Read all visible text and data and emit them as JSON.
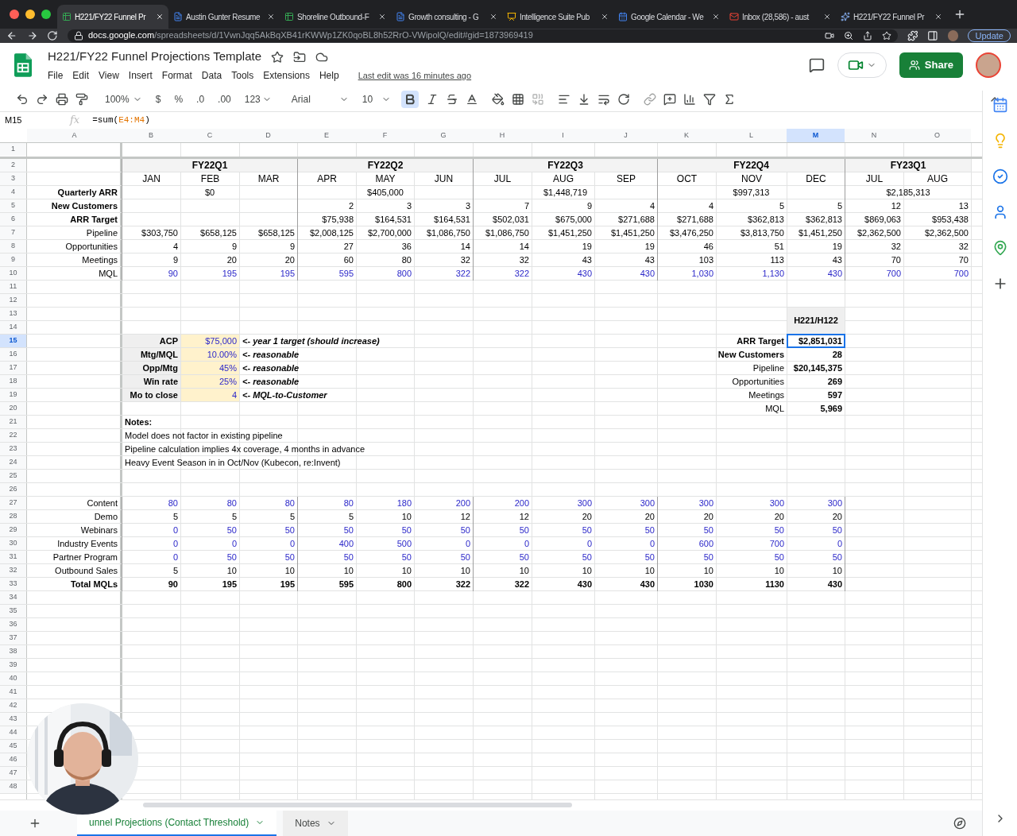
{
  "browser": {
    "tabs": [
      {
        "label": "H221/FY22 Funnel Pr",
        "kind": "sheets",
        "selected": true
      },
      {
        "label": "Austin Gunter Resume",
        "kind": "docs",
        "selected": false
      },
      {
        "label": "Shoreline Outbound-F",
        "kind": "sheets",
        "selected": false
      },
      {
        "label": "Growth consulting - G",
        "kind": "docs",
        "selected": false
      },
      {
        "label": "Intelligence Suite Pub",
        "kind": "slides",
        "selected": false
      },
      {
        "label": "Google Calendar - We",
        "kind": "calendar",
        "selected": false
      },
      {
        "label": "Inbox (28,586) - aust",
        "kind": "mail",
        "selected": false
      },
      {
        "label": "H221/FY22 Funnel Pr",
        "kind": "spark",
        "selected": false
      }
    ],
    "address": {
      "host": "docs.google.com",
      "path": "/spreadsheets/d/1VwnJqq5AkBqXB41rKWWp1ZK0qoBL8h52RrO-VWipolQ/edit#gid=1873969419"
    },
    "update_button": "Update"
  },
  "doc": {
    "title": "H221/FY22 Funnel Projections Template",
    "menu": [
      "File",
      "Edit",
      "View",
      "Insert",
      "Format",
      "Data",
      "Tools",
      "Extensions",
      "Help"
    ],
    "last_edit": "Last edit was 16 minutes ago",
    "share": "Share"
  },
  "toolbar": {
    "zoom": "100%",
    "currency": "$",
    "percent": "%",
    "decrease_decimals": ".0",
    "increase_decimals": ".00",
    "more_formats": "123",
    "font": "Arial",
    "font_size": "10",
    "bold_on": true
  },
  "formula_bar": {
    "name_box": "M15",
    "fx": "fx",
    "prefix": "=sum(",
    "ref": "E4:M4",
    "suffix": ")"
  },
  "columns": [
    {
      "label": "A",
      "selected": false
    },
    {
      "label": "B",
      "selected": false
    },
    {
      "label": "C",
      "selected": false
    },
    {
      "label": "D",
      "selected": false
    },
    {
      "label": "E",
      "selected": false
    },
    {
      "label": "F",
      "selected": false
    },
    {
      "label": "G",
      "selected": false
    },
    {
      "label": "H",
      "selected": false
    },
    {
      "label": "I",
      "selected": false
    },
    {
      "label": "J",
      "selected": false
    },
    {
      "label": "K",
      "selected": false
    },
    {
      "label": "L",
      "selected": false
    },
    {
      "label": "M",
      "selected": true
    },
    {
      "label": "N",
      "selected": false
    },
    {
      "label": "O",
      "selected": false
    }
  ],
  "rows": [
    {
      "n": "1",
      "selected": false,
      "kind": "empty"
    },
    {
      "n": "2",
      "selected": false,
      "kind": "quarters",
      "values": [
        "FY22Q1",
        "FY22Q2",
        "FY22Q3",
        "FY22Q4",
        "FY23Q1"
      ]
    },
    {
      "n": "3",
      "selected": false,
      "kind": "months",
      "values": [
        "JAN",
        "FEB",
        "MAR",
        "APR",
        "MAY",
        "JUN",
        "JUL",
        "AUG",
        "SEP",
        "OCT",
        "NOV",
        "DEC",
        "JUL",
        "AUG"
      ]
    },
    {
      "n": "4",
      "selected": false,
      "kind": "quarterly",
      "label": "Quarterly ARR",
      "values": [
        "$0",
        "$405,000",
        "$1,448,719",
        "$997,313",
        "$2,185,313"
      ]
    },
    {
      "n": "5",
      "selected": false,
      "kind": "q2start",
      "label": "New Customers",
      "label_bold": true,
      "values": [
        "2",
        "3",
        "3",
        "7",
        "9",
        "4",
        "4",
        "5",
        "5",
        "12",
        "13"
      ]
    },
    {
      "n": "6",
      "selected": false,
      "kind": "q2start",
      "label": "ARR Target",
      "label_bold": true,
      "values": [
        "$75,938",
        "$164,531",
        "$164,531",
        "$502,031",
        "$675,000",
        "$271,688",
        "$271,688",
        "$362,813",
        "$362,813",
        "$869,063",
        "$953,438"
      ]
    },
    {
      "n": "7",
      "selected": false,
      "kind": "plain",
      "label": "Pipeline",
      "label_bold": false,
      "values": [
        "$303,750",
        "$658,125",
        "$658,125",
        "$2,008,125",
        "$2,700,000",
        "$1,086,750",
        "$1,086,750",
        "$1,451,250",
        "$1,451,250",
        "$3,476,250",
        "$3,813,750",
        "$1,451,250",
        "$2,362,500",
        "$2,362,500"
      ]
    },
    {
      "n": "8",
      "selected": false,
      "kind": "plain",
      "label": "Opportunities",
      "label_bold": false,
      "values": [
        "4",
        "9",
        "9",
        "27",
        "36",
        "14",
        "14",
        "19",
        "19",
        "46",
        "51",
        "19",
        "32",
        "32"
      ]
    },
    {
      "n": "9",
      "selected": false,
      "kind": "plain",
      "label": "Meetings",
      "label_bold": false,
      "values": [
        "9",
        "20",
        "20",
        "60",
        "80",
        "32",
        "32",
        "43",
        "43",
        "103",
        "113",
        "43",
        "70",
        "70"
      ]
    },
    {
      "n": "10",
      "selected": false,
      "kind": "blue",
      "label": "MQL",
      "label_bold": false,
      "values": [
        "90",
        "195",
        "195",
        "595",
        "800",
        "322",
        "322",
        "430",
        "430",
        "1,030",
        "1,130",
        "430",
        "700",
        "700"
      ]
    },
    {
      "n": "11",
      "selected": false,
      "kind": "empty"
    },
    {
      "n": "12",
      "selected": false,
      "kind": "empty"
    },
    {
      "n": "13",
      "selected": false,
      "kind": "block",
      "summary_header": "H221/H122"
    },
    {
      "n": "14",
      "selected": false,
      "kind": "empty"
    },
    {
      "n": "15",
      "selected": true,
      "kind": "block",
      "key": "ACP",
      "input": "$75,000",
      "note": "<- year 1 target (should increase)",
      "summary_label": "ARR Target",
      "summary_label_bold": true,
      "summary_value": "$2,851,031"
    },
    {
      "n": "16",
      "selected": false,
      "kind": "block",
      "key": "Mtg/MQL",
      "input": "10.00%",
      "note": "<- reasonable",
      "summary_label": "New Customers",
      "summary_label_bold": true,
      "summary_value": "28"
    },
    {
      "n": "17",
      "selected": false,
      "kind": "block",
      "key": "Opp/Mtg",
      "input": "45%",
      "note": "<- reasonable",
      "summary_label": "Pipeline",
      "summary_label_bold": false,
      "summary_value": "$20,145,375"
    },
    {
      "n": "18",
      "selected": false,
      "kind": "block",
      "key": "Win rate",
      "input": "25%",
      "note": "<- reasonable",
      "summary_label": "Opportunities",
      "summary_label_bold": false,
      "summary_value": "269"
    },
    {
      "n": "19",
      "selected": false,
      "kind": "block",
      "key": "Mo to close",
      "input": "4",
      "note": "<- MQL-to-Customer",
      "summary_label": "Meetings",
      "summary_label_bold": false,
      "summary_value": "597"
    },
    {
      "n": "20",
      "selected": false,
      "kind": "block",
      "summary_label": "MQL",
      "summary_label_bold": false,
      "summary_value": "5,969"
    },
    {
      "n": "21",
      "selected": false,
      "kind": "note",
      "text": "Notes:",
      "bold": true
    },
    {
      "n": "22",
      "selected": false,
      "kind": "note",
      "text": "Model does not factor in existing pipeline",
      "bold": false
    },
    {
      "n": "23",
      "selected": false,
      "kind": "note",
      "text": "Pipeline calculation implies 4x coverage, 4 months in advance",
      "bold": false
    },
    {
      "n": "24",
      "selected": false,
      "kind": "note",
      "text": "Heavy Event Season in in Oct/Nov (Kubecon, re:Invent)",
      "bold": false
    },
    {
      "n": "25",
      "selected": false,
      "kind": "empty"
    },
    {
      "n": "26",
      "selected": false,
      "kind": "empty"
    },
    {
      "n": "27",
      "selected": false,
      "kind": "blue",
      "label": "Content",
      "label_bold": false,
      "values": [
        "80",
        "80",
        "80",
        "80",
        "180",
        "200",
        "200",
        "300",
        "300",
        "300",
        "300",
        "300"
      ]
    },
    {
      "n": "28",
      "selected": false,
      "kind": "plain",
      "label": "Demo",
      "label_bold": false,
      "values": [
        "5",
        "5",
        "5",
        "5",
        "10",
        "12",
        "12",
        "20",
        "20",
        "20",
        "20",
        "20"
      ]
    },
    {
      "n": "29",
      "selected": false,
      "kind": "blue",
      "label": "Webinars",
      "label_bold": false,
      "values": [
        "0",
        "50",
        "50",
        "50",
        "50",
        "50",
        "50",
        "50",
        "50",
        "50",
        "50",
        "50"
      ]
    },
    {
      "n": "30",
      "selected": false,
      "kind": "blue",
      "label": "Industry Events",
      "label_bold": false,
      "values": [
        "0",
        "0",
        "0",
        "400",
        "500",
        "0",
        "0",
        "0",
        "0",
        "600",
        "700",
        "0"
      ]
    },
    {
      "n": "31",
      "selected": false,
      "kind": "blue",
      "label": "Partner Program",
      "label_bold": false,
      "values": [
        "0",
        "50",
        "50",
        "50",
        "50",
        "50",
        "50",
        "50",
        "50",
        "50",
        "50",
        "50"
      ]
    },
    {
      "n": "32",
      "selected": false,
      "kind": "plain",
      "label": "Outbound Sales",
      "label_bold": false,
      "values": [
        "5",
        "10",
        "10",
        "10",
        "10",
        "10",
        "10",
        "10",
        "10",
        "10",
        "10",
        "10"
      ]
    },
    {
      "n": "33",
      "selected": false,
      "kind": "bold",
      "label": "Total MQLs",
      "label_bold": true,
      "values": [
        "90",
        "195",
        "195",
        "595",
        "800",
        "322",
        "322",
        "430",
        "430",
        "1030",
        "1130",
        "430"
      ]
    },
    {
      "n": "34",
      "selected": false,
      "kind": "empty"
    },
    {
      "n": "35",
      "selected": false,
      "kind": "empty"
    },
    {
      "n": "36",
      "selected": false,
      "kind": "empty"
    },
    {
      "n": "37",
      "selected": false,
      "kind": "empty"
    },
    {
      "n": "38",
      "selected": false,
      "kind": "empty"
    },
    {
      "n": "39",
      "selected": false,
      "kind": "empty"
    },
    {
      "n": "40",
      "selected": false,
      "kind": "empty"
    },
    {
      "n": "41",
      "selected": false,
      "kind": "empty"
    },
    {
      "n": "42",
      "selected": false,
      "kind": "empty"
    },
    {
      "n": "43",
      "selected": false,
      "kind": "empty"
    },
    {
      "n": "44",
      "selected": false,
      "kind": "empty"
    },
    {
      "n": "45",
      "selected": false,
      "kind": "empty"
    },
    {
      "n": "46",
      "selected": false,
      "kind": "empty"
    },
    {
      "n": "47",
      "selected": false,
      "kind": "empty"
    },
    {
      "n": "48",
      "selected": false,
      "kind": "empty"
    }
  ],
  "sheet_tabs": [
    {
      "label": "unnel Projections (Contact Threshold)",
      "selected": true
    },
    {
      "label": "Notes",
      "selected": false
    }
  ]
}
